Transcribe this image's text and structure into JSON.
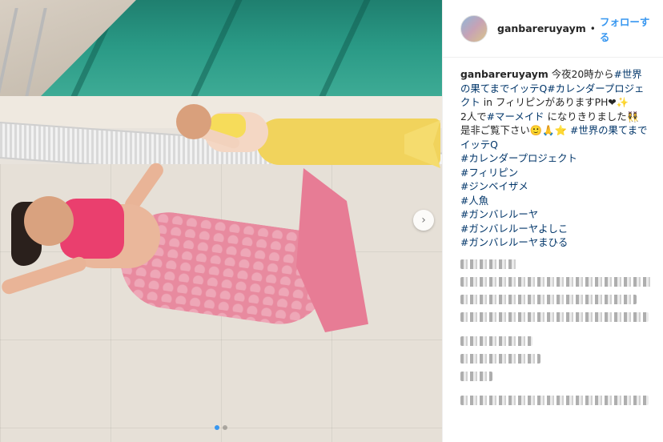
{
  "post": {
    "username": "ganbareruyaym",
    "separator": "•",
    "follow_label": "フォローする",
    "caption": {
      "username": "ganbareruyaym",
      "lines": [
        {
          "plain": "今夜20時から",
          "tag": "#世界の果てまでイッテQ"
        },
        {
          "plain": "",
          "tag": "#カレンダープロジェクト"
        },
        {
          "plain": "in フィリピンがありますPH❤✨",
          "tag": ""
        },
        {
          "plain": "2人で",
          "tag": "#マーメイド"
        },
        {
          "plain": "になりきりました👯‍♀️",
          "tag": ""
        },
        {
          "plain": "是非ご覧下さい🙂🙏⭐",
          "tag": "#世界の果てまでイッテQ"
        }
      ],
      "hashtags": [
        "#カレンダープロジェクト",
        "#フィリピン",
        "#ジンベイザメ",
        "#人魚",
        "#ガンバレルーヤ",
        "#ガンバレルーヤよしこ",
        "#ガンバレルーヤまひる"
      ]
    },
    "next_icon": "›",
    "carousel": {
      "count": 2,
      "active": 0
    },
    "colors": {
      "link": "#3897f0",
      "hashtag": "#003569"
    }
  }
}
